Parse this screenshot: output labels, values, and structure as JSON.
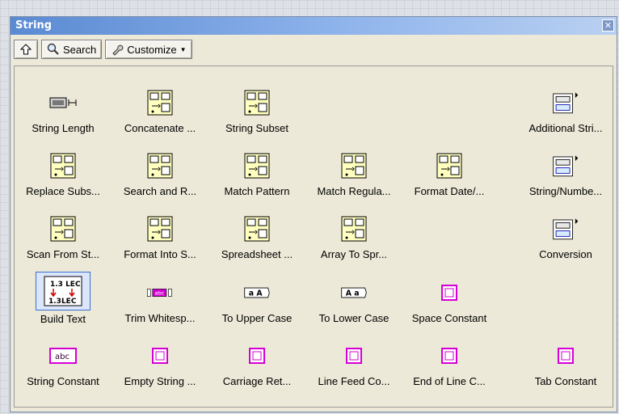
{
  "title": "String",
  "toolbar": {
    "search_label": "Search",
    "customize_label": "Customize"
  },
  "items": [
    {
      "id": "string-length",
      "label": "String Length",
      "kind": "chip",
      "icon": "string-length-icon"
    },
    {
      "id": "concatenate",
      "label": "Concatenate ...",
      "kind": "yellow",
      "icon": "concatenate-strings-icon"
    },
    {
      "id": "string-subset",
      "label": "String Subset",
      "kind": "yellow",
      "icon": "string-subset-icon"
    },
    {
      "id": "additional",
      "label": "Additional Stri...",
      "kind": "submenu",
      "icon": "additional-string-functions-icon"
    },
    {
      "id": "replace-substring",
      "label": "Replace Subs...",
      "kind": "yellow",
      "icon": "replace-substring-icon"
    },
    {
      "id": "search-replace",
      "label": "Search and R...",
      "kind": "yellow",
      "icon": "search-replace-icon"
    },
    {
      "id": "match-pattern",
      "label": "Match Pattern",
      "kind": "yellow",
      "icon": "match-pattern-icon"
    },
    {
      "id": "match-regex",
      "label": "Match Regula...",
      "kind": "yellow",
      "icon": "match-regex-icon"
    },
    {
      "id": "format-date",
      "label": "Format Date/...",
      "kind": "yellow",
      "icon": "format-date-time-icon"
    },
    {
      "id": "string-number",
      "label": "String/Numbe...",
      "kind": "submenu",
      "icon": "string-number-conversion-icon"
    },
    {
      "id": "scan-from-string",
      "label": "Scan From St...",
      "kind": "yellow",
      "icon": "scan-from-string-icon"
    },
    {
      "id": "format-into-string",
      "label": "Format Into S...",
      "kind": "yellow",
      "icon": "format-into-string-icon"
    },
    {
      "id": "spreadsheet",
      "label": "Spreadsheet ...",
      "kind": "yellow",
      "icon": "spreadsheet-to-array-icon"
    },
    {
      "id": "array-to-spreadsheet",
      "label": "Array To Spr...",
      "kind": "yellow",
      "icon": "array-to-spreadsheet-icon"
    },
    {
      "id": "conversion",
      "label": "Conversion",
      "kind": "submenu",
      "icon": "conversion-icon"
    },
    {
      "id": "build-text",
      "label": "Build Text",
      "kind": "build",
      "icon": "build-text-icon"
    },
    {
      "id": "trim-whitespace",
      "label": "Trim Whitesp...",
      "kind": "trim",
      "icon": "trim-whitespace-icon"
    },
    {
      "id": "to-upper-case",
      "label": "To Upper Case",
      "kind": "case",
      "glyph": "a A",
      "icon": "to-upper-case-icon"
    },
    {
      "id": "to-lower-case",
      "label": "To Lower Case",
      "kind": "case",
      "glyph": "A a",
      "icon": "to-lower-case-icon"
    },
    {
      "id": "space-constant",
      "label": "Space Constant",
      "kind": "pinkbox",
      "icon": "space-constant-icon"
    },
    {
      "id": "string-constant",
      "label": "String Constant",
      "kind": "abc",
      "icon": "string-constant-icon"
    },
    {
      "id": "empty-string",
      "label": "Empty String ...",
      "kind": "pinkbox",
      "icon": "empty-string-icon"
    },
    {
      "id": "carriage-return",
      "label": "Carriage Ret...",
      "kind": "pinkbox",
      "icon": "carriage-return-icon"
    },
    {
      "id": "line-feed",
      "label": "Line Feed Co...",
      "kind": "pinkbox",
      "icon": "line-feed-icon"
    },
    {
      "id": "end-of-line",
      "label": "End of Line C...",
      "kind": "pinkbox",
      "icon": "end-of-line-icon"
    },
    {
      "id": "tab-constant",
      "label": "Tab Constant",
      "kind": "pinkbox",
      "icon": "tab-constant-icon"
    }
  ],
  "colors": {
    "accent": "#5a8ad2",
    "pink": "#d600d6",
    "yellow": "#ffffc0"
  }
}
